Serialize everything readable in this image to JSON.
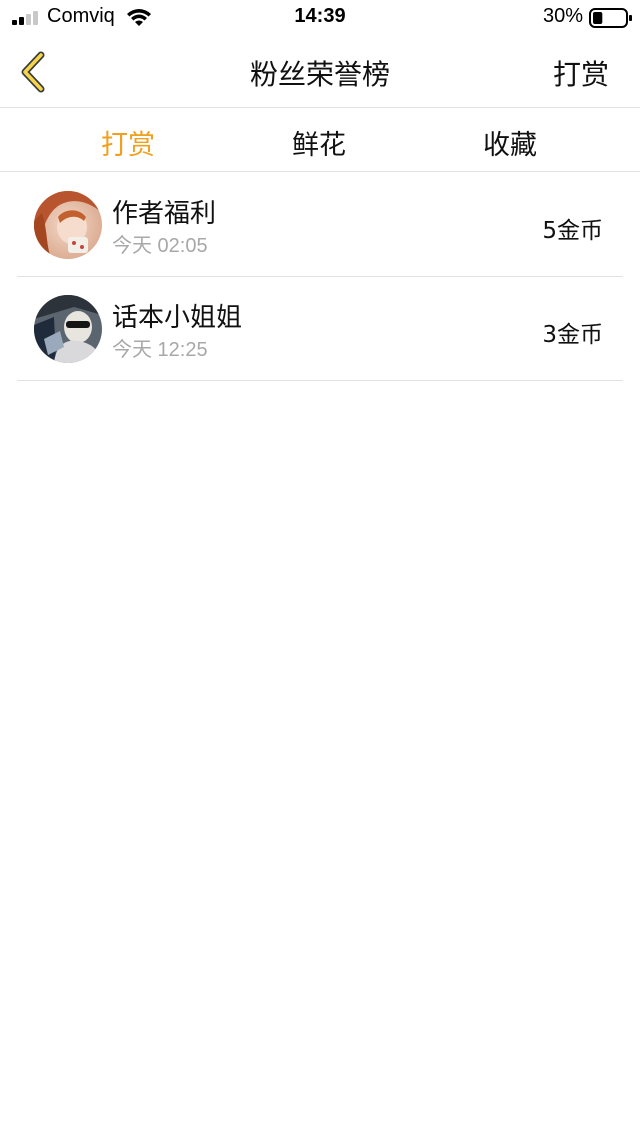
{
  "status_bar": {
    "carrier": "Comviq",
    "time": "14:39",
    "battery_percent": "30%",
    "battery_level": 0.3
  },
  "nav": {
    "title": "粉丝荣誉榜",
    "action_label": "打赏",
    "accent_color": "#f0a01e"
  },
  "tabs": [
    {
      "label": "打赏",
      "active": true
    },
    {
      "label": "鲜花",
      "active": false
    },
    {
      "label": "收藏",
      "active": false
    }
  ],
  "entries": [
    {
      "name": "作者福利",
      "time": "今天 02:05",
      "amount": "5金币"
    },
    {
      "name": "话本小姐姐",
      "time": "今天 12:25",
      "amount": "3金币"
    }
  ]
}
